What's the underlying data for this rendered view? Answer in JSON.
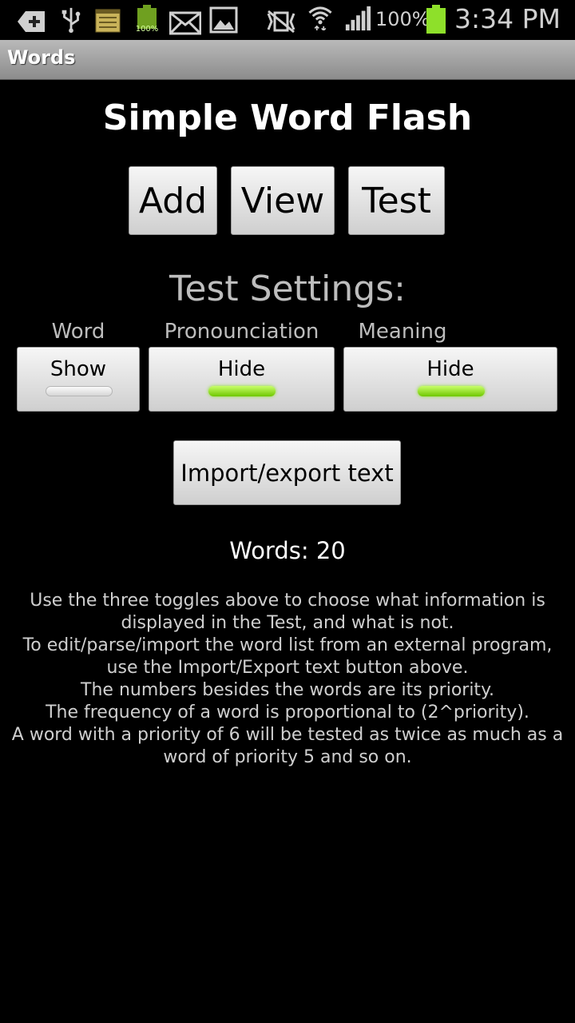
{
  "status_bar": {
    "battery_icon_text": "100%",
    "battery_percent": "100%",
    "time": "3:34 PM",
    "icons": [
      "add-icon",
      "usb-icon",
      "notes-icon",
      "battery-full-icon",
      "mail-icon",
      "image-icon",
      "vibrate-icon",
      "wifi-icon",
      "signal-icon",
      "battery-icon"
    ]
  },
  "title_bar": {
    "title": "Words"
  },
  "main": {
    "app_title": "Simple Word Flash",
    "buttons": {
      "add": "Add",
      "view": "View",
      "test": "Test"
    },
    "settings_title": "Test Settings:",
    "toggles": [
      {
        "label": "Word",
        "value": "Show",
        "on": false
      },
      {
        "label": "Pronounciation",
        "value": "Hide",
        "on": true
      },
      {
        "label": "Meaning",
        "value": "Hide",
        "on": true
      }
    ],
    "import_export": "Import/export text",
    "word_count": "Words: 20",
    "help_lines": [
      "Use the three toggles above to choose what information is",
      "displayed in the Test, and what is not.",
      "To edit/parse/import the word list from an external program,",
      "use the Import/Export text button above.",
      "The numbers besides the words are its priority.",
      "The frequency of a word is proportional to (2^priority).",
      "A word with a priority of 6 will be tested as twice as much as a",
      "word of priority 5 and so on."
    ]
  },
  "colors": {
    "toggle_on": "#8ee02a",
    "background": "#000000",
    "settings_text": "#bdbdbd"
  }
}
